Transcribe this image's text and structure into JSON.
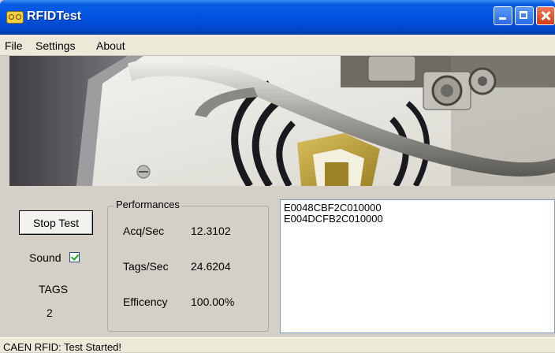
{
  "window": {
    "title": "RFIDTest"
  },
  "menu": {
    "items": [
      "File",
      "Settings",
      "About"
    ]
  },
  "controls": {
    "stop_button_label": "Stop Test",
    "sound_label": "Sound",
    "sound_checked": true,
    "tags_label": "TAGS",
    "tags_count": "2"
  },
  "performances": {
    "title": "Performances",
    "rows": [
      {
        "label": "Acq/Sec",
        "value": "12.3102"
      },
      {
        "label": "Tags/Sec",
        "value": "24.6204"
      },
      {
        "label": "Efficency",
        "value": "100.00%"
      }
    ]
  },
  "tag_list": [
    "E0048CBF2C010000",
    "E004DCFB2C010000"
  ],
  "status": {
    "text": "CAEN RFID: Test Started!"
  },
  "colors": {
    "title_bar": "#0054e3",
    "window_bg": "#d4d0c8",
    "close_button": "#d23c17"
  }
}
